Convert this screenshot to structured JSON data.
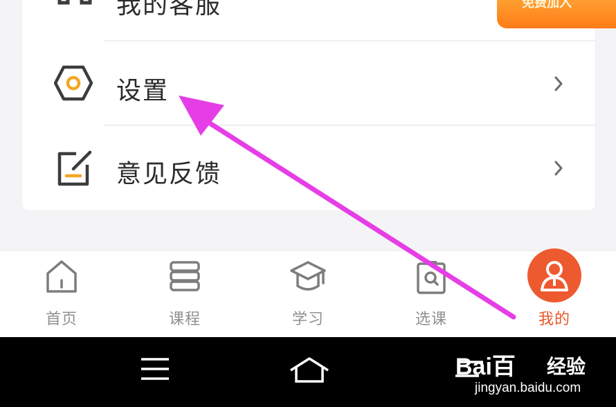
{
  "menu": {
    "items": [
      {
        "label": "我的客服",
        "icon": "headset-icon"
      },
      {
        "label": "设置",
        "icon": "settings-hexagon-icon"
      },
      {
        "label": "意见反馈",
        "icon": "feedback-edit-icon"
      }
    ]
  },
  "promo": {
    "text": "免费加入"
  },
  "tabs": [
    {
      "label": "首页",
      "icon": "home-icon"
    },
    {
      "label": "课程",
      "icon": "books-icon"
    },
    {
      "label": "学习",
      "icon": "graduation-cap-icon"
    },
    {
      "label": "选课",
      "icon": "search-clipboard-icon"
    },
    {
      "label": "我的",
      "icon": "user-icon"
    }
  ],
  "active_tab": "我的",
  "watermark": {
    "brand": "Bai百",
    "subtitle": "经验",
    "url": "jingyan.baidu.com"
  },
  "colors": {
    "accent": "#ee5a2f",
    "annotation_arrow": "#e63ee6",
    "icon_orange": "#f5a623"
  }
}
